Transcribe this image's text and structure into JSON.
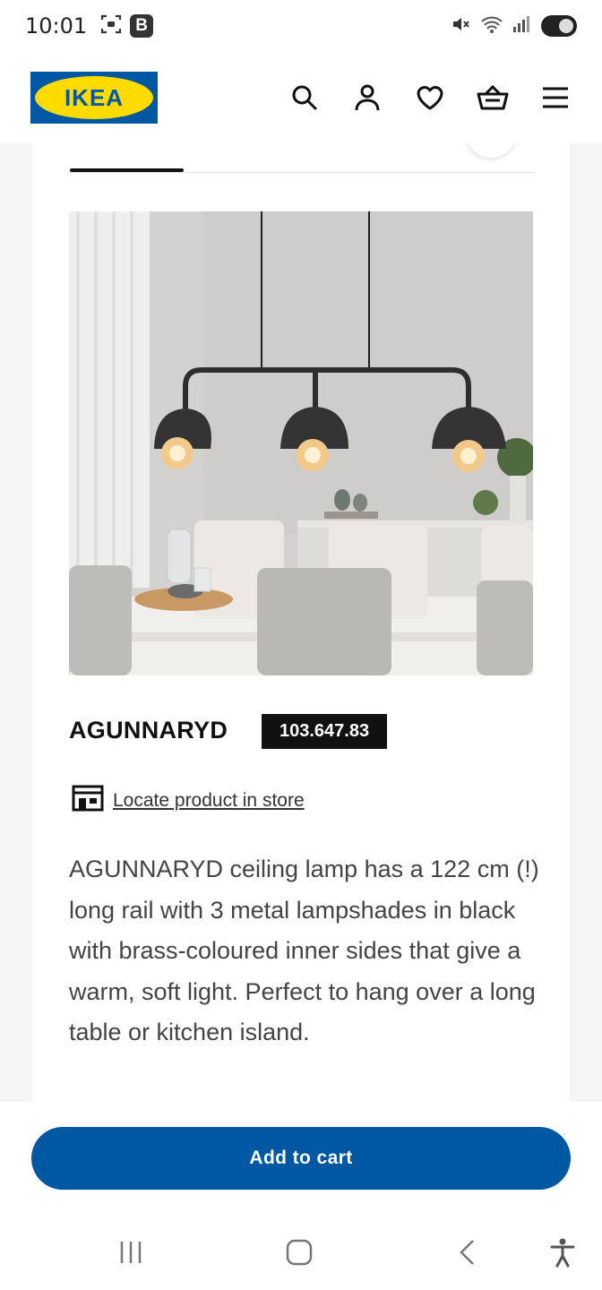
{
  "status_bar": {
    "time": "10:01",
    "left_icons": [
      "screenshot-icon",
      "b-badge-icon"
    ],
    "right_icons": [
      "mute-icon",
      "wifi-icon",
      "signal-icon",
      "battery-icon"
    ],
    "b_badge": "B"
  },
  "header": {
    "logo_text": "IKEA",
    "icons": [
      "search-icon",
      "account-icon",
      "heart-icon",
      "basket-icon",
      "menu-icon"
    ]
  },
  "product": {
    "name": "AGUNNARYD",
    "article_number": "103.647.83",
    "locate_label": "Locate product in store",
    "description": "AGUNNARYD ceiling lamp has a 122 cm (!) long rail with 3 metal lampshades in black with brass-coloured inner sides that give a warm, soft light. Perfect to hang over a long table or kitchen island."
  },
  "actions": {
    "add_to_cart_label": "Add to cart"
  },
  "colors": {
    "brand_blue": "#0058a3",
    "brand_yellow": "#ffdb00",
    "badge_bg": "#111111"
  },
  "nav_bar": {
    "icons": [
      "recents-icon",
      "home-icon",
      "back-icon",
      "accessibility-icon"
    ]
  }
}
